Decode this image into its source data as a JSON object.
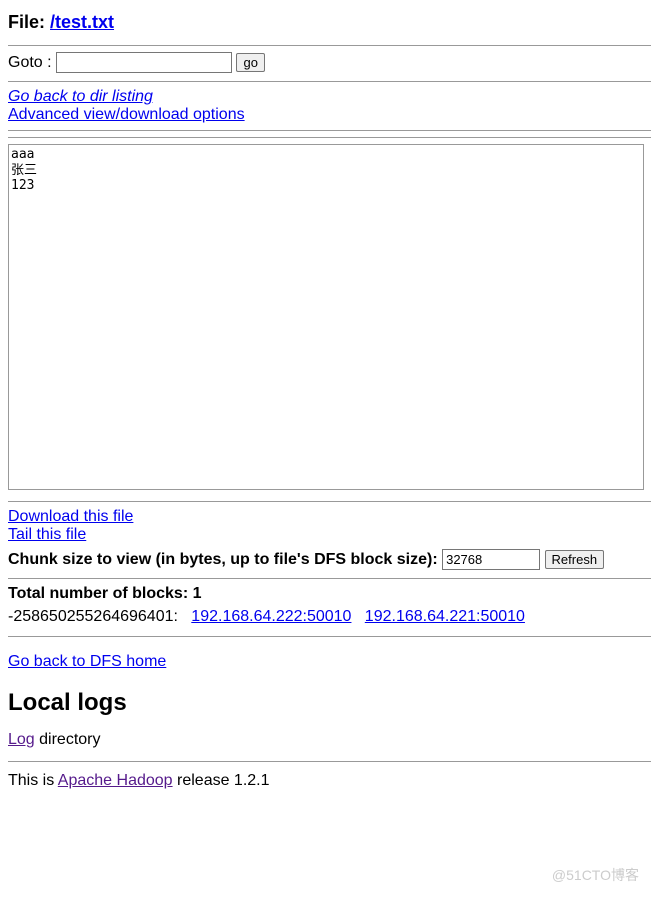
{
  "header": {
    "file_prefix": "File: ",
    "file_path": "/test.txt"
  },
  "goto": {
    "label": "Goto : ",
    "value": "",
    "button": "go"
  },
  "nav_links": {
    "back_dir": "Go back to dir listing",
    "advanced": "Advanced view/download options"
  },
  "file_contents": "aaa\n张三\n123",
  "download": {
    "download": "Download this file",
    "tail": "Tail this file"
  },
  "chunk": {
    "label": "Chunk size to view (in bytes, up to file's DFS block size): ",
    "value": "32768",
    "button": "Refresh"
  },
  "blocks": {
    "label": "Total number of blocks: 1",
    "block_id": "-258650255264696401:",
    "replica1": "192.168.64.222:50010",
    "replica2": "192.168.64.221:50010"
  },
  "dfs_home": "Go back to DFS home",
  "logs": {
    "heading": "Local logs",
    "log_link": "Log",
    "directory_text": " directory"
  },
  "footer": {
    "prefix": "This is ",
    "hadoop_link": "Apache Hadoop",
    "suffix": " release 1.2.1"
  },
  "watermark": "@51CTO博客"
}
